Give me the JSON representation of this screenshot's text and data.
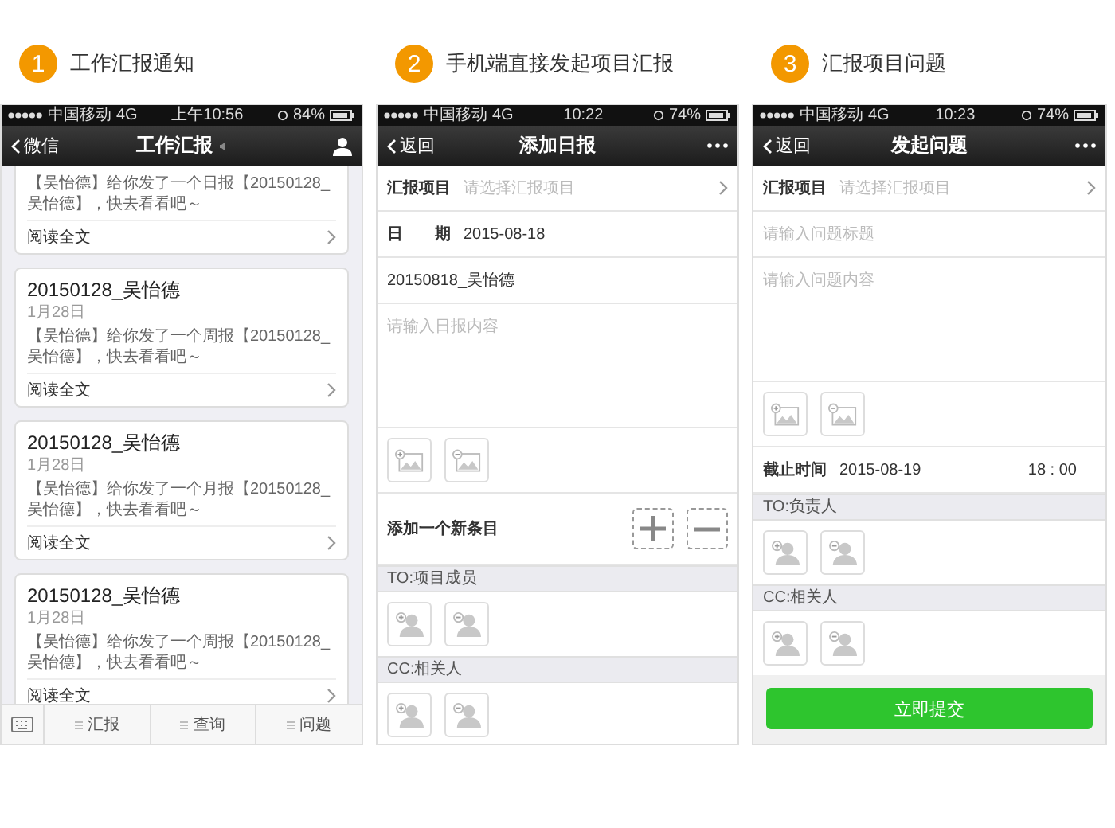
{
  "panels": [
    {
      "kind": "feed",
      "number": "1",
      "caption": "工作汇报通知",
      "status": {
        "carrier": "中国移动",
        "network": "4G",
        "time": "上午10:56",
        "battery": "84%"
      },
      "nav": {
        "back": "微信",
        "title": "工作汇报",
        "kind": "profile"
      },
      "cards": [
        {
          "message": "【吴怡德】给你发了一个日报【20150128_吴怡德】，快去看看吧～",
          "link": "阅读全文"
        },
        {
          "title": "20150128_吴怡德",
          "date": "1月28日",
          "message": "【吴怡德】给你发了一个周报【20150128_吴怡德】，快去看看吧～",
          "link": "阅读全文"
        },
        {
          "title": "20150128_吴怡德",
          "date": "1月28日",
          "message": "【吴怡德】给你发了一个月报【20150128_吴怡德】，快去看看吧～",
          "link": "阅读全文"
        },
        {
          "title": "20150128_吴怡德",
          "date": "1月28日",
          "message": "【吴怡德】给你发了一个周报【20150128_吴怡德】，快去看看吧～",
          "link": "阅读全文"
        }
      ],
      "tabs": [
        "汇报",
        "查询",
        "问题"
      ]
    },
    {
      "kind": "form",
      "number": "2",
      "caption": "手机端直接发起项目汇报",
      "status": {
        "carrier": "中国移动",
        "network": "4G",
        "time": "10:22",
        "battery": "74%"
      },
      "nav": {
        "back": "返回",
        "title": "添加日报",
        "kind": "more"
      },
      "fields": [
        {
          "kind": "select",
          "label": "汇报项目",
          "placeholder": "请选择汇报项目"
        },
        {
          "kind": "labeled",
          "label": "日　　期",
          "value": "2015-08-18"
        },
        {
          "kind": "text",
          "value": "20150818_吴怡德"
        },
        {
          "kind": "textarea",
          "placeholder": "请输入日报内容"
        },
        {
          "kind": "images"
        },
        {
          "kind": "add_item",
          "label": "添加一个新条目"
        },
        {
          "kind": "section",
          "label": "TO:项目成员"
        },
        {
          "kind": "people"
        },
        {
          "kind": "section",
          "label": "CC:相关人"
        },
        {
          "kind": "people"
        }
      ]
    },
    {
      "kind": "form",
      "number": "3",
      "caption": "汇报项目问题",
      "status": {
        "carrier": "中国移动",
        "network": "4G",
        "time": "10:23",
        "battery": "74%"
      },
      "nav": {
        "back": "返回",
        "title": "发起问题",
        "kind": "more"
      },
      "fields": [
        {
          "kind": "select",
          "label": "汇报项目",
          "placeholder": "请选择汇报项目"
        },
        {
          "kind": "input",
          "placeholder": "请输入问题标题"
        },
        {
          "kind": "textarea",
          "placeholder": "请输入问题内容"
        },
        {
          "kind": "images"
        },
        {
          "kind": "deadline",
          "label": "截止时间",
          "date": "2015-08-19",
          "time": "18 : 00"
        },
        {
          "kind": "section",
          "label": "TO:负责人"
        },
        {
          "kind": "people"
        },
        {
          "kind": "section",
          "label": "CC:相关人"
        },
        {
          "kind": "people"
        },
        {
          "kind": "submit",
          "label": "立即提交"
        }
      ]
    }
  ]
}
